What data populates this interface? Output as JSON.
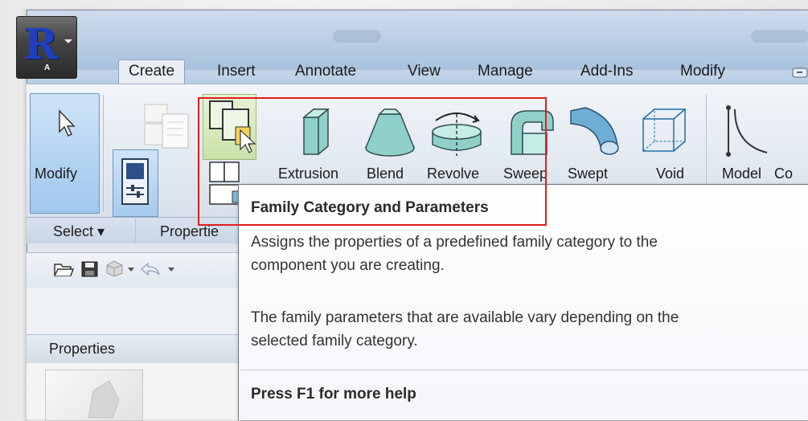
{
  "app": {
    "logo_letter": "A"
  },
  "tabs": [
    "Create",
    "Insert",
    "Annotate",
    "View",
    "Manage",
    "Add-Ins",
    "Modify"
  ],
  "ribbon": {
    "modify_label": "Modify",
    "forms": [
      "Extrusion",
      "Blend",
      "Revolve",
      "Sweep",
      "Swept",
      "Void"
    ],
    "model_labels": [
      "Model",
      "Co"
    ],
    "panels": {
      "select": "Select ▾",
      "properties": "Propertie"
    }
  },
  "tooltip": {
    "title": "Family Category and Parameters",
    "desc_line1": "Assigns the properties of a predefined family category to the",
    "desc_line2": "component you are creating.",
    "desc_line3": "The family parameters that are available vary depending on the",
    "desc_line4": "selected family category.",
    "help": "Press F1 for more help"
  },
  "properties_palette": {
    "title": "Properties"
  },
  "colors": {
    "highlight_box": "#e01d1d",
    "active_button": "#9fc7ee"
  }
}
